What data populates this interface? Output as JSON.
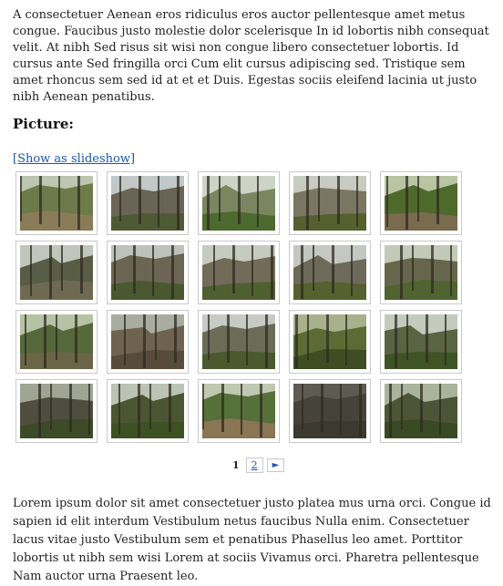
{
  "article": {
    "intro_text": "A consectetuer Aenean eros ridiculus eros auctor pellentesque amet metus congue. Faucibus justo molestie dolor scelerisque In id lobortis nibh consequat velit. At nibh Sed risus sit wisi non congue libero consectetuer lobortis. Id cursus ante Sed fringilla orci Cum elit cursus adipiscing sed. Tristique sem amet rhoncus sem sed id at et et Duis. Egestas sociis eleifend lacinia ut justo nibh Aenean penatibus.",
    "heading": "Picture:",
    "slideshow_link": "[Show as slideshow]",
    "outro_text": "Lorem ipsum dolor sit amet consectetuer justo platea mus urna orci. Congue id sapien id elit interdum Vestibulum netus faucibus Nulla enim. Consectetuer lacus vitae justo Vestibulum sem et penatibus Phasellus leo amet. Porttitor lobortis ut nibh sem wisi Lorem at sociis Vivamus orci. Pharetra pellentesque Nam auctor urna Praesent leo."
  },
  "gallery": {
    "thumbnails": [
      {
        "subject": "forest slope with rocks",
        "sky": "#bcc6b0",
        "mid": "#6d7a4a",
        "ground": "#8a7c58"
      },
      {
        "subject": "ruined stone wall",
        "sky": "#c2c8c8",
        "mid": "#6a6456",
        "ground": "#4f5a34"
      },
      {
        "subject": "castle ruin in forest",
        "sky": "#cdd4c6",
        "mid": "#7a8660",
        "ground": "#4d6a2e"
      },
      {
        "subject": "rock face among trees",
        "sky": "#c8cbc0",
        "mid": "#7b7664",
        "ground": "#55602e"
      },
      {
        "subject": "forest path",
        "sky": "#b8c4a2",
        "mid": "#4e6a2a",
        "ground": "#7a6a4e"
      },
      {
        "subject": "steep wall and path",
        "sky": "#c0c6bc",
        "mid": "#595d46",
        "ground": "#6e6a52"
      },
      {
        "subject": "crumbling wall",
        "sky": "#bdc2ba",
        "mid": "#6d6553",
        "ground": "#4a5830"
      },
      {
        "subject": "ruin wall with trees",
        "sky": "#c6cbc0",
        "mid": "#716b58",
        "ground": "#4f6030"
      },
      {
        "subject": "rocky ruin",
        "sky": "#c4c7c2",
        "mid": "#6e6a5a",
        "ground": "#56612f"
      },
      {
        "subject": "ruin under canopy",
        "sky": "#c2c9b6",
        "mid": "#66664c",
        "ground": "#4f6430"
      },
      {
        "subject": "overgrown slope",
        "sky": "#b6c2a4",
        "mid": "#55683a",
        "ground": "#6b6548"
      },
      {
        "subject": "stone wall close-up",
        "sky": "#a9ad9f",
        "mid": "#6f6350",
        "ground": "#574c3a"
      },
      {
        "subject": "wall behind trees",
        "sky": "#c7cbc4",
        "mid": "#6a6c58",
        "ground": "#4a5a2e"
      },
      {
        "subject": "mossy rock face",
        "sky": "#a8b08c",
        "mid": "#5c6b34",
        "ground": "#3f4e22"
      },
      {
        "subject": "trees and wall",
        "sky": "#c4cabc",
        "mid": "#5a6442",
        "ground": "#3f5424"
      },
      {
        "subject": "dark forest wall",
        "sky": "#a0a593",
        "mid": "#4f4e3e",
        "ground": "#3d4a28"
      },
      {
        "subject": "trees by wall",
        "sky": "#bcc3b4",
        "mid": "#4b5532",
        "ground": "#3c5222"
      },
      {
        "subject": "forest trail",
        "sky": "#c0c8b2",
        "mid": "#56703a",
        "ground": "#8a7554"
      },
      {
        "subject": "dark stone texture",
        "sky": "#5d5b52",
        "mid": "#46443a",
        "ground": "#3a3a30"
      },
      {
        "subject": "ruin in dense forest",
        "sky": "#aab39c",
        "mid": "#4d5536",
        "ground": "#3a4a24"
      }
    ]
  },
  "pager": {
    "current": "1",
    "page2": "2",
    "next": "►"
  }
}
